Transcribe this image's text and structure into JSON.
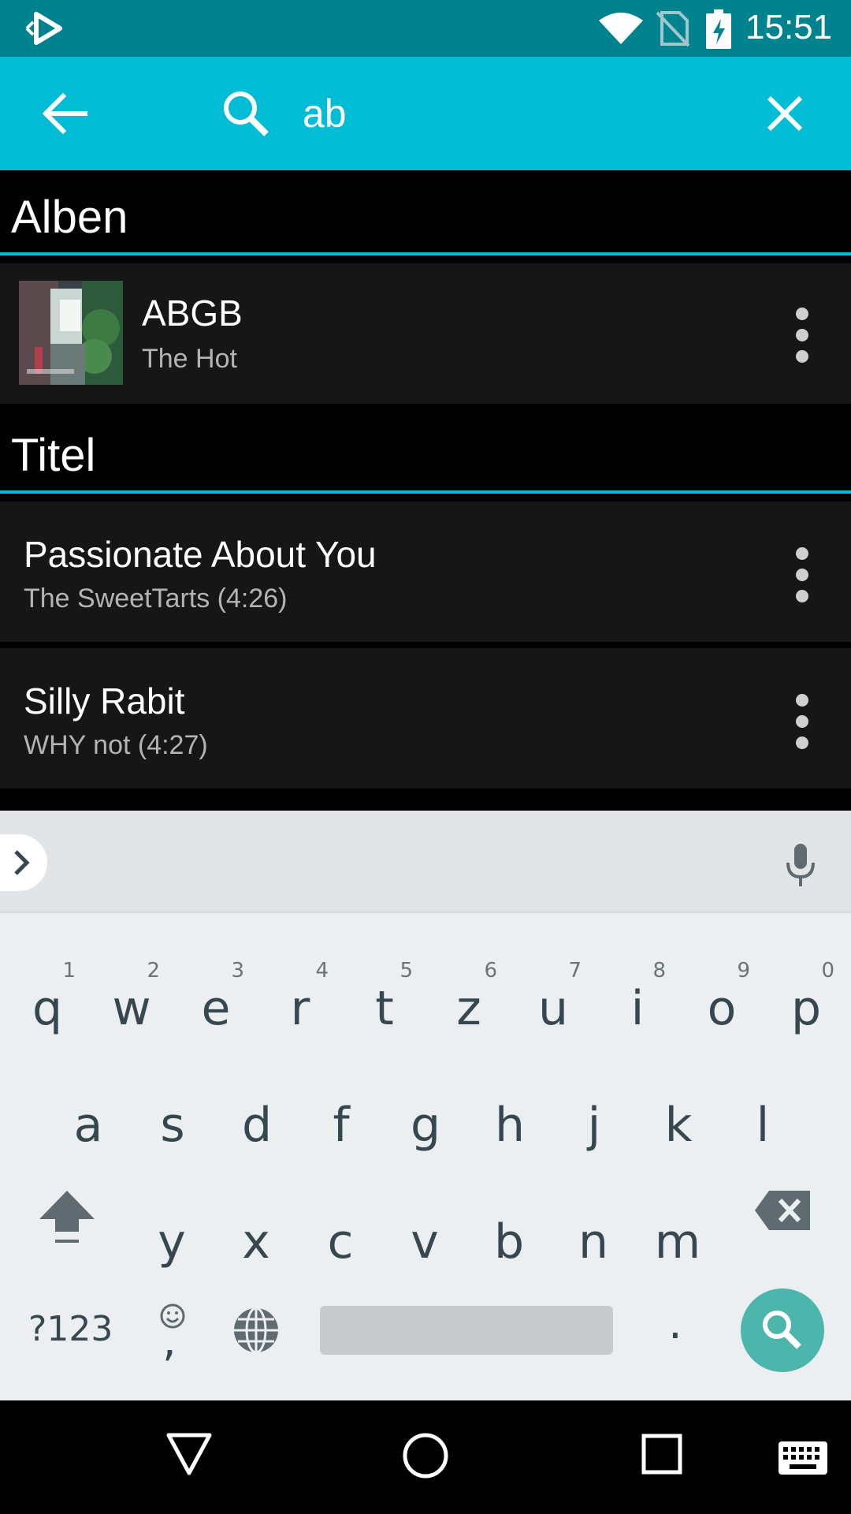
{
  "status_bar": {
    "time": "15:51",
    "icons": [
      "app-notification-icon",
      "wifi-icon",
      "no-sim-icon",
      "battery-charging-icon"
    ]
  },
  "search_bar": {
    "query": "ab",
    "icons": [
      "back-arrow-icon",
      "search-icon",
      "close-icon"
    ]
  },
  "sections": {
    "albums": {
      "header": "Alben",
      "items": [
        {
          "title": "ABGB",
          "subtitle": "The Hot"
        }
      ]
    },
    "tracks": {
      "header": "Titel",
      "items": [
        {
          "title": "Passionate About You",
          "subtitle": "The SweetTarts (4:26)"
        },
        {
          "title": "Silly Rabit",
          "subtitle": "WHY not (4:27)"
        }
      ]
    }
  },
  "keyboard": {
    "row1": [
      {
        "key": "q",
        "hint": "1"
      },
      {
        "key": "w",
        "hint": "2"
      },
      {
        "key": "e",
        "hint": "3"
      },
      {
        "key": "r",
        "hint": "4"
      },
      {
        "key": "t",
        "hint": "5"
      },
      {
        "key": "z",
        "hint": "6"
      },
      {
        "key": "u",
        "hint": "7"
      },
      {
        "key": "i",
        "hint": "8"
      },
      {
        "key": "o",
        "hint": "9"
      },
      {
        "key": "p",
        "hint": "0"
      }
    ],
    "row2": [
      "a",
      "s",
      "d",
      "f",
      "g",
      "h",
      "j",
      "k",
      "l"
    ],
    "row3": [
      "y",
      "x",
      "c",
      "v",
      "b",
      "n",
      "m"
    ],
    "symbols_key": "?123",
    "comma_key": ",",
    "period_key": ".",
    "icons": [
      "expand-suggestions-icon",
      "microphone-icon",
      "shift-icon",
      "backspace-icon",
      "emoji-icon",
      "globe-icon",
      "search-icon"
    ]
  },
  "nav_bar": {
    "icons": [
      "back-triangle-icon",
      "home-circle-icon",
      "recents-square-icon",
      "keyboard-switch-icon"
    ]
  },
  "colors": {
    "status_bar": "#00838f",
    "toolbar": "#00bcd4",
    "accent_rule": "#00bcd4",
    "row_background": "#161616",
    "keyboard_background": "#eceff1",
    "search_key": "#4db6ac"
  }
}
